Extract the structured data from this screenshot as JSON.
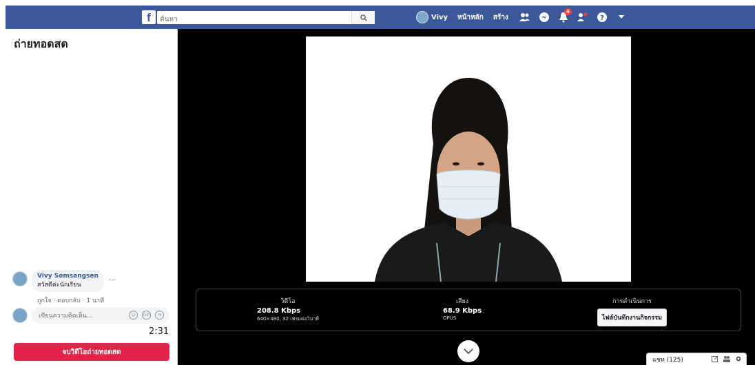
{
  "topbar": {
    "logo": "f",
    "search_placeholder": "ค้นหา",
    "user_name": "Vivy",
    "home_label": "หน้าหลัก",
    "create_label": "สร้าง",
    "notification_count": "4",
    "brand_color": "#3b5998"
  },
  "live": {
    "title": "ถ่ายทอดสด",
    "timer": "2:31",
    "end_button": "จบวิดีโอถ่ายทอดสด"
  },
  "comments": [
    {
      "author": "Vivy Somsangsen",
      "text": "สวัสดีค่ะนักเรียน",
      "like_label": "ถูกใจ",
      "reply_label": "ตอบกลับ",
      "time": "1 นาที"
    }
  ],
  "reply": {
    "placeholder": "เขียนความคิดเห็น..."
  },
  "stats": {
    "video": {
      "label": "วิดีโอ",
      "bitrate": "208.8 Kbps",
      "detail": "640×480, 32 เฟรมต่อวินาที"
    },
    "audio": {
      "label": "เสียง",
      "bitrate": "68.9 Kbps",
      "codec": "OPUS"
    },
    "actions": {
      "label": "การดำเนินการ",
      "button": "ไฟล์บันทึกงานกิจกรรม"
    }
  },
  "chat": {
    "label": "แชท (125)"
  },
  "colors": {
    "end_button": "#e4234b",
    "stage_bg": "#000000"
  }
}
